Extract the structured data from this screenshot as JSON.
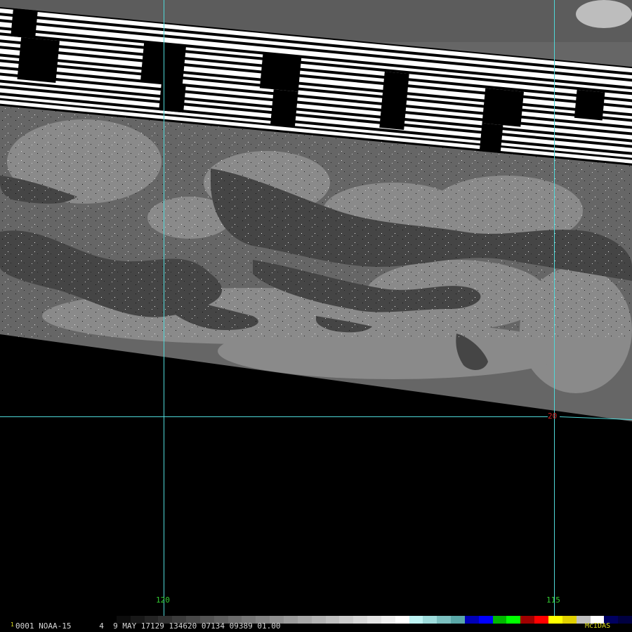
{
  "map": {
    "longitude_labels": [
      "120",
      "115"
    ],
    "latitude_label": "20",
    "grid_color": "#4fd8d8",
    "longitude_label_color": "#33cc33",
    "latitude_label_color": "#cc2222"
  },
  "footer": {
    "frame_prefix": "1",
    "caption": "0001 NOAA-15      4  9 MAY 17129 134620 07134 09389 01.00",
    "text_color": "#d8d8d8",
    "brand": "McIDAS",
    "brand_color": "#e0e020",
    "colorbar": [
      "#000000",
      "#0c0c0c",
      "#181818",
      "#242424",
      "#303030",
      "#3c3c3c",
      "#484848",
      "#545454",
      "#606060",
      "#6c6c6c",
      "#787878",
      "#848484",
      "#909090",
      "#9c9c9c",
      "#a8a8a8",
      "#b4b4b4",
      "#c0c0c0",
      "#cccccc",
      "#d8d8d8",
      "#e4e4e4",
      "#f0f0f0",
      "#ffffff",
      "#bff4f4",
      "#9edcdc",
      "#7cc0c0",
      "#5aa8a8",
      "#0000b8",
      "#0000ff",
      "#00b800",
      "#00ff00",
      "#a00000",
      "#ff0000",
      "#ffff00",
      "#e0d000",
      "#c0c0c0",
      "#ffffff",
      "#000060",
      "#000040"
    ]
  }
}
